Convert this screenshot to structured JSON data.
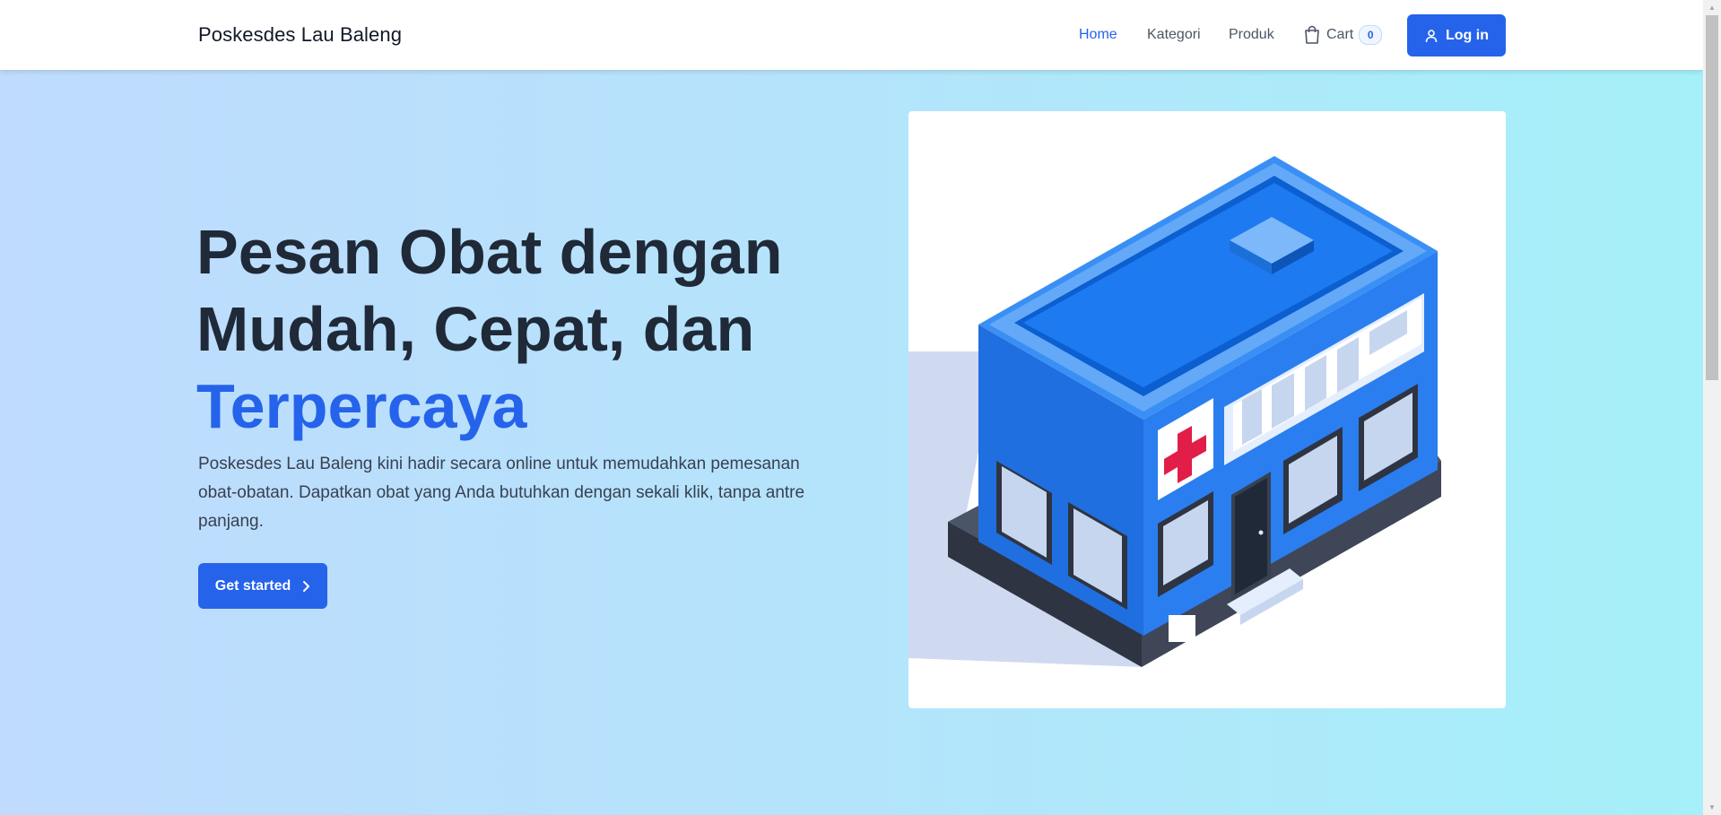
{
  "navbar": {
    "brand": "Poskesdes Lau Baleng",
    "links": [
      {
        "label": "Home",
        "active": true
      },
      {
        "label": "Kategori",
        "active": false
      },
      {
        "label": "Produk",
        "active": false
      }
    ],
    "cart": {
      "label": "Cart",
      "count": "0",
      "icon": "shopping-bag-icon"
    },
    "login": {
      "label": "Log in",
      "icon": "user-icon"
    }
  },
  "hero": {
    "title_line1": "Pesan Obat dengan",
    "title_line2": "Mudah, Cepat, dan",
    "title_accent": "Terpercaya",
    "description": "Poskesdes Lau Baleng kini hadir secara online untuk memudahkan pemesanan obat-obatan. Dapatkan obat yang Anda butuhkan dengan sekali klik, tanpa antre panjang.",
    "cta_label": "Get started",
    "cta_icon": "chevron-right-icon"
  },
  "illustration": {
    "icon": "health-clinic-building-illustration"
  },
  "colors": {
    "accent": "#2563eb",
    "heading": "#1f2937",
    "text": "#374151",
    "background_start": "#bfdbfe",
    "background_end": "#a5f0f9",
    "cross_red": "#e11d48"
  }
}
